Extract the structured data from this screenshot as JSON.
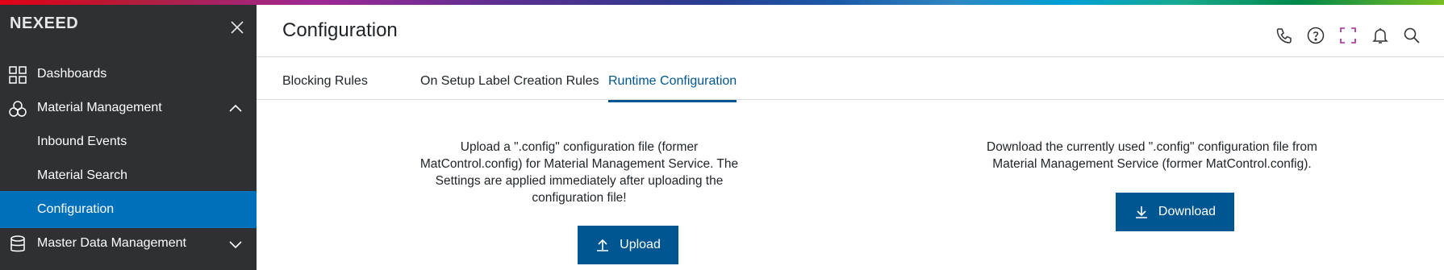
{
  "brand": {
    "name": "NEXEED"
  },
  "colors": {
    "sidebar_bg": "#2e3034",
    "active_item": "#0070ba",
    "primary": "#005691"
  },
  "sidebar": {
    "items": [
      {
        "label": "Dashboards",
        "icon": "dashboard-grid-icon"
      },
      {
        "label": "Material Management",
        "icon": "material-management-icon",
        "expanded": true
      },
      {
        "label": "Inbound Events"
      },
      {
        "label": "Material Search"
      },
      {
        "label": "Configuration",
        "active": true
      },
      {
        "label": "Master Data Management",
        "icon": "database-icon",
        "expanded": false
      }
    ]
  },
  "header": {
    "title": "Configuration",
    "icons": [
      "phone-icon",
      "help-icon",
      "fullscreen-icon",
      "bell-icon",
      "search-icon"
    ]
  },
  "tabs": [
    {
      "label": "Blocking Rules"
    },
    {
      "label": "On Setup Label Creation Rules"
    },
    {
      "label": "Runtime Configuration",
      "active": true
    }
  ],
  "upload": {
    "line1": "Upload a \".config\" configuration file (former",
    "line2": "MatControl.config) for Material Management Service. The",
    "line3": "Settings are applied immediately after uploading the",
    "line4": "configuration file!",
    "button_label": "Upload"
  },
  "download": {
    "line1": "Download the currently used \".config\" configuration file from",
    "line2": "Material Management Service (former MatControl.config).",
    "button_label": "Download"
  }
}
